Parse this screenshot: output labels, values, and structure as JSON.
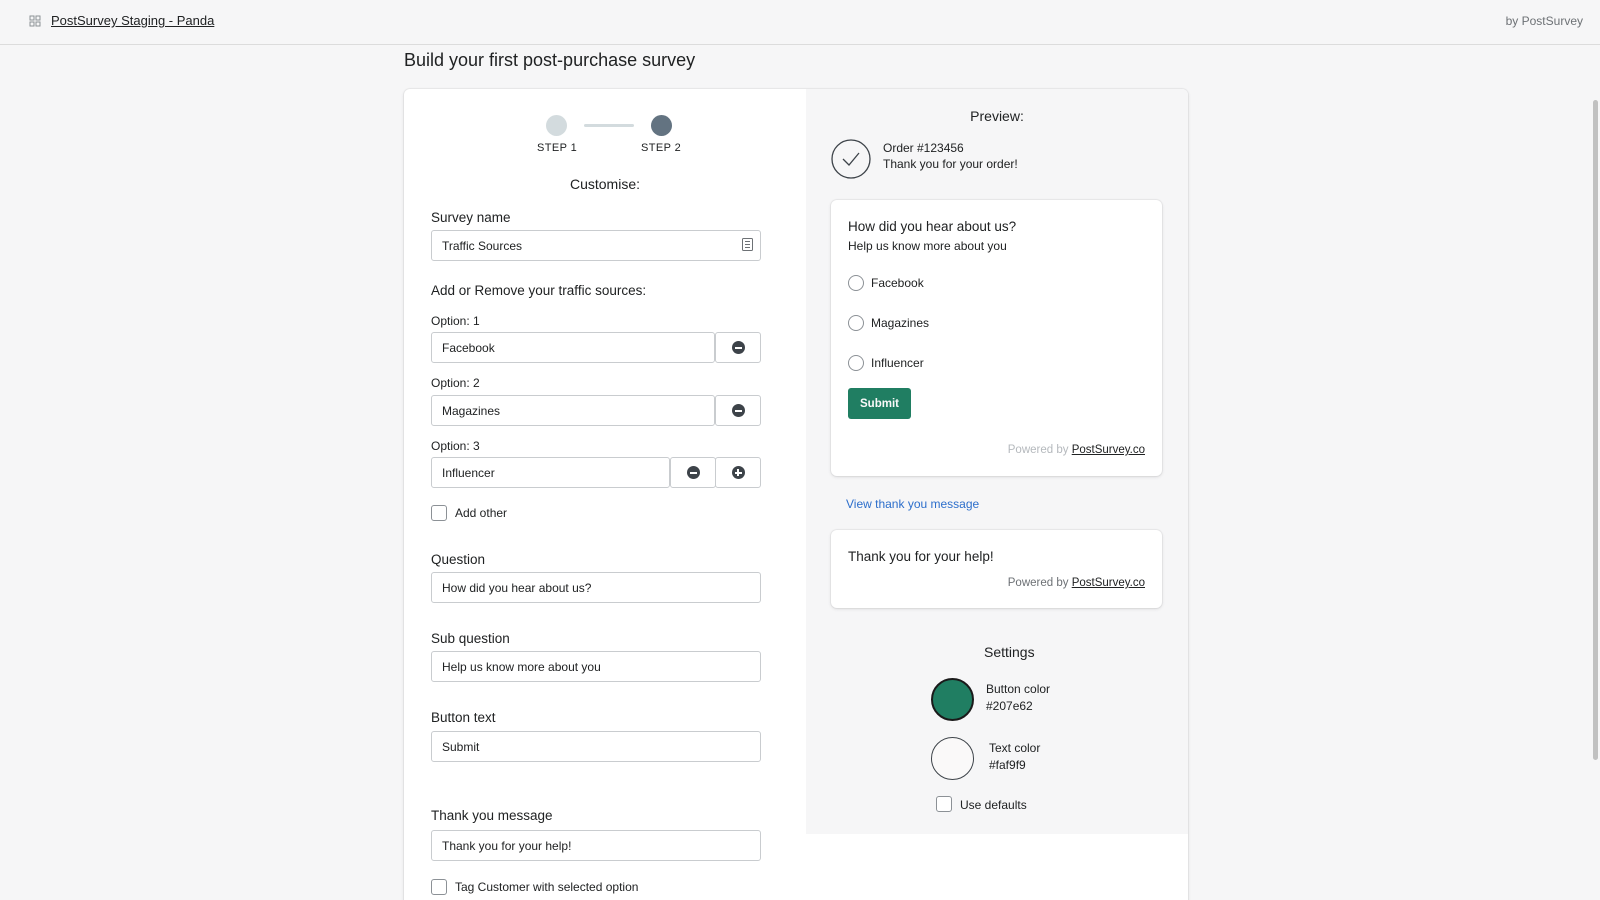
{
  "topbar": {
    "app_title": "PostSurvey Staging - Panda",
    "by_label": "by PostSurvey"
  },
  "page": {
    "heading": "Build your first post-purchase survey"
  },
  "stepper": {
    "step1": "STEP 1",
    "step2": "STEP 2",
    "active_step": 2
  },
  "form": {
    "customise_title": "Customise:",
    "survey_name_label": "Survey name",
    "survey_name_value": "Traffic Sources",
    "sources_label": "Add or Remove your traffic sources:",
    "options": [
      {
        "label": "Option: 1",
        "value": "Facebook"
      },
      {
        "label": "Option: 2",
        "value": "Magazines"
      },
      {
        "label": "Option: 3",
        "value": "Influencer"
      }
    ],
    "add_other_label": "Add other",
    "question_label": "Question",
    "question_value": "How did you hear about us?",
    "sub_question_label": "Sub question",
    "sub_question_value": "Help us know more about you",
    "button_text_label": "Button text",
    "button_text_value": "Submit",
    "thank_you_label": "Thank you message",
    "thank_you_value": "Thank you for your help!",
    "tag_customer_label": "Tag Customer with selected option"
  },
  "preview": {
    "title": "Preview:",
    "order_number": "Order #123456",
    "order_thanks": "Thank you for your order!",
    "question": "How did you hear about us?",
    "sub_question": "Help us know more about you",
    "choices": [
      "Facebook",
      "Magazines",
      "Influencer"
    ],
    "submit_label": "Submit",
    "powered_prefix": "Powered by",
    "powered_link": "PostSurvey.co",
    "view_thanks_link": "View thank you message",
    "thanks_message": "Thank you for your help!"
  },
  "settings": {
    "title": "Settings",
    "button_color_label": "Button color",
    "button_color_value": "#207e62",
    "text_color_label": "Text color",
    "text_color_value": "#faf9f9",
    "use_defaults_label": "Use defaults"
  },
  "colors": {
    "accent": "#207e62",
    "text_on_accent": "#faf9f9",
    "link": "#2c6ecb"
  }
}
